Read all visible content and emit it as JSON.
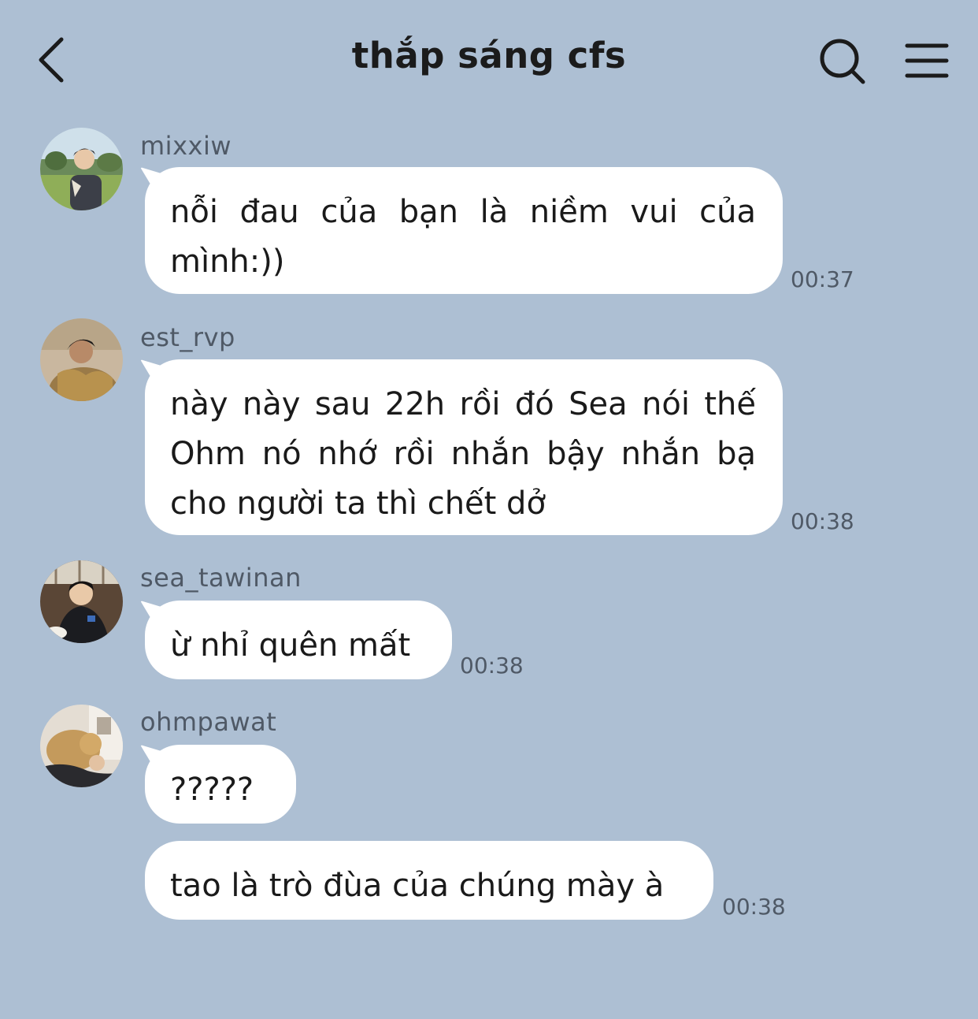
{
  "header": {
    "title": "thắp sáng cfs"
  },
  "messages": [
    {
      "username": "mixxiw",
      "lines": [
        "nỗi đau của bạn là niềm vui của",
        "mình:))"
      ],
      "time": "00:37"
    },
    {
      "username": "est_rvp",
      "lines": [
        "này này sau 22h rồi đó Sea nói thế",
        "Ohm nó nhớ rồi nhắn bậy nhắn bạ",
        "cho người ta thì chết dở"
      ],
      "time": "00:38"
    },
    {
      "username": "sea_tawinan",
      "lines": [
        "ừ nhỉ quên mất"
      ],
      "time": "00:38"
    },
    {
      "username": "ohmpawat",
      "lines": [
        "?????"
      ],
      "time": ""
    },
    {
      "username": "",
      "lines": [
        "tao là trò đùa của chúng mày à"
      ],
      "time": "00:38"
    }
  ],
  "icons": {
    "back": "chevron-left-icon",
    "search": "search-icon",
    "menu": "menu-icon"
  }
}
